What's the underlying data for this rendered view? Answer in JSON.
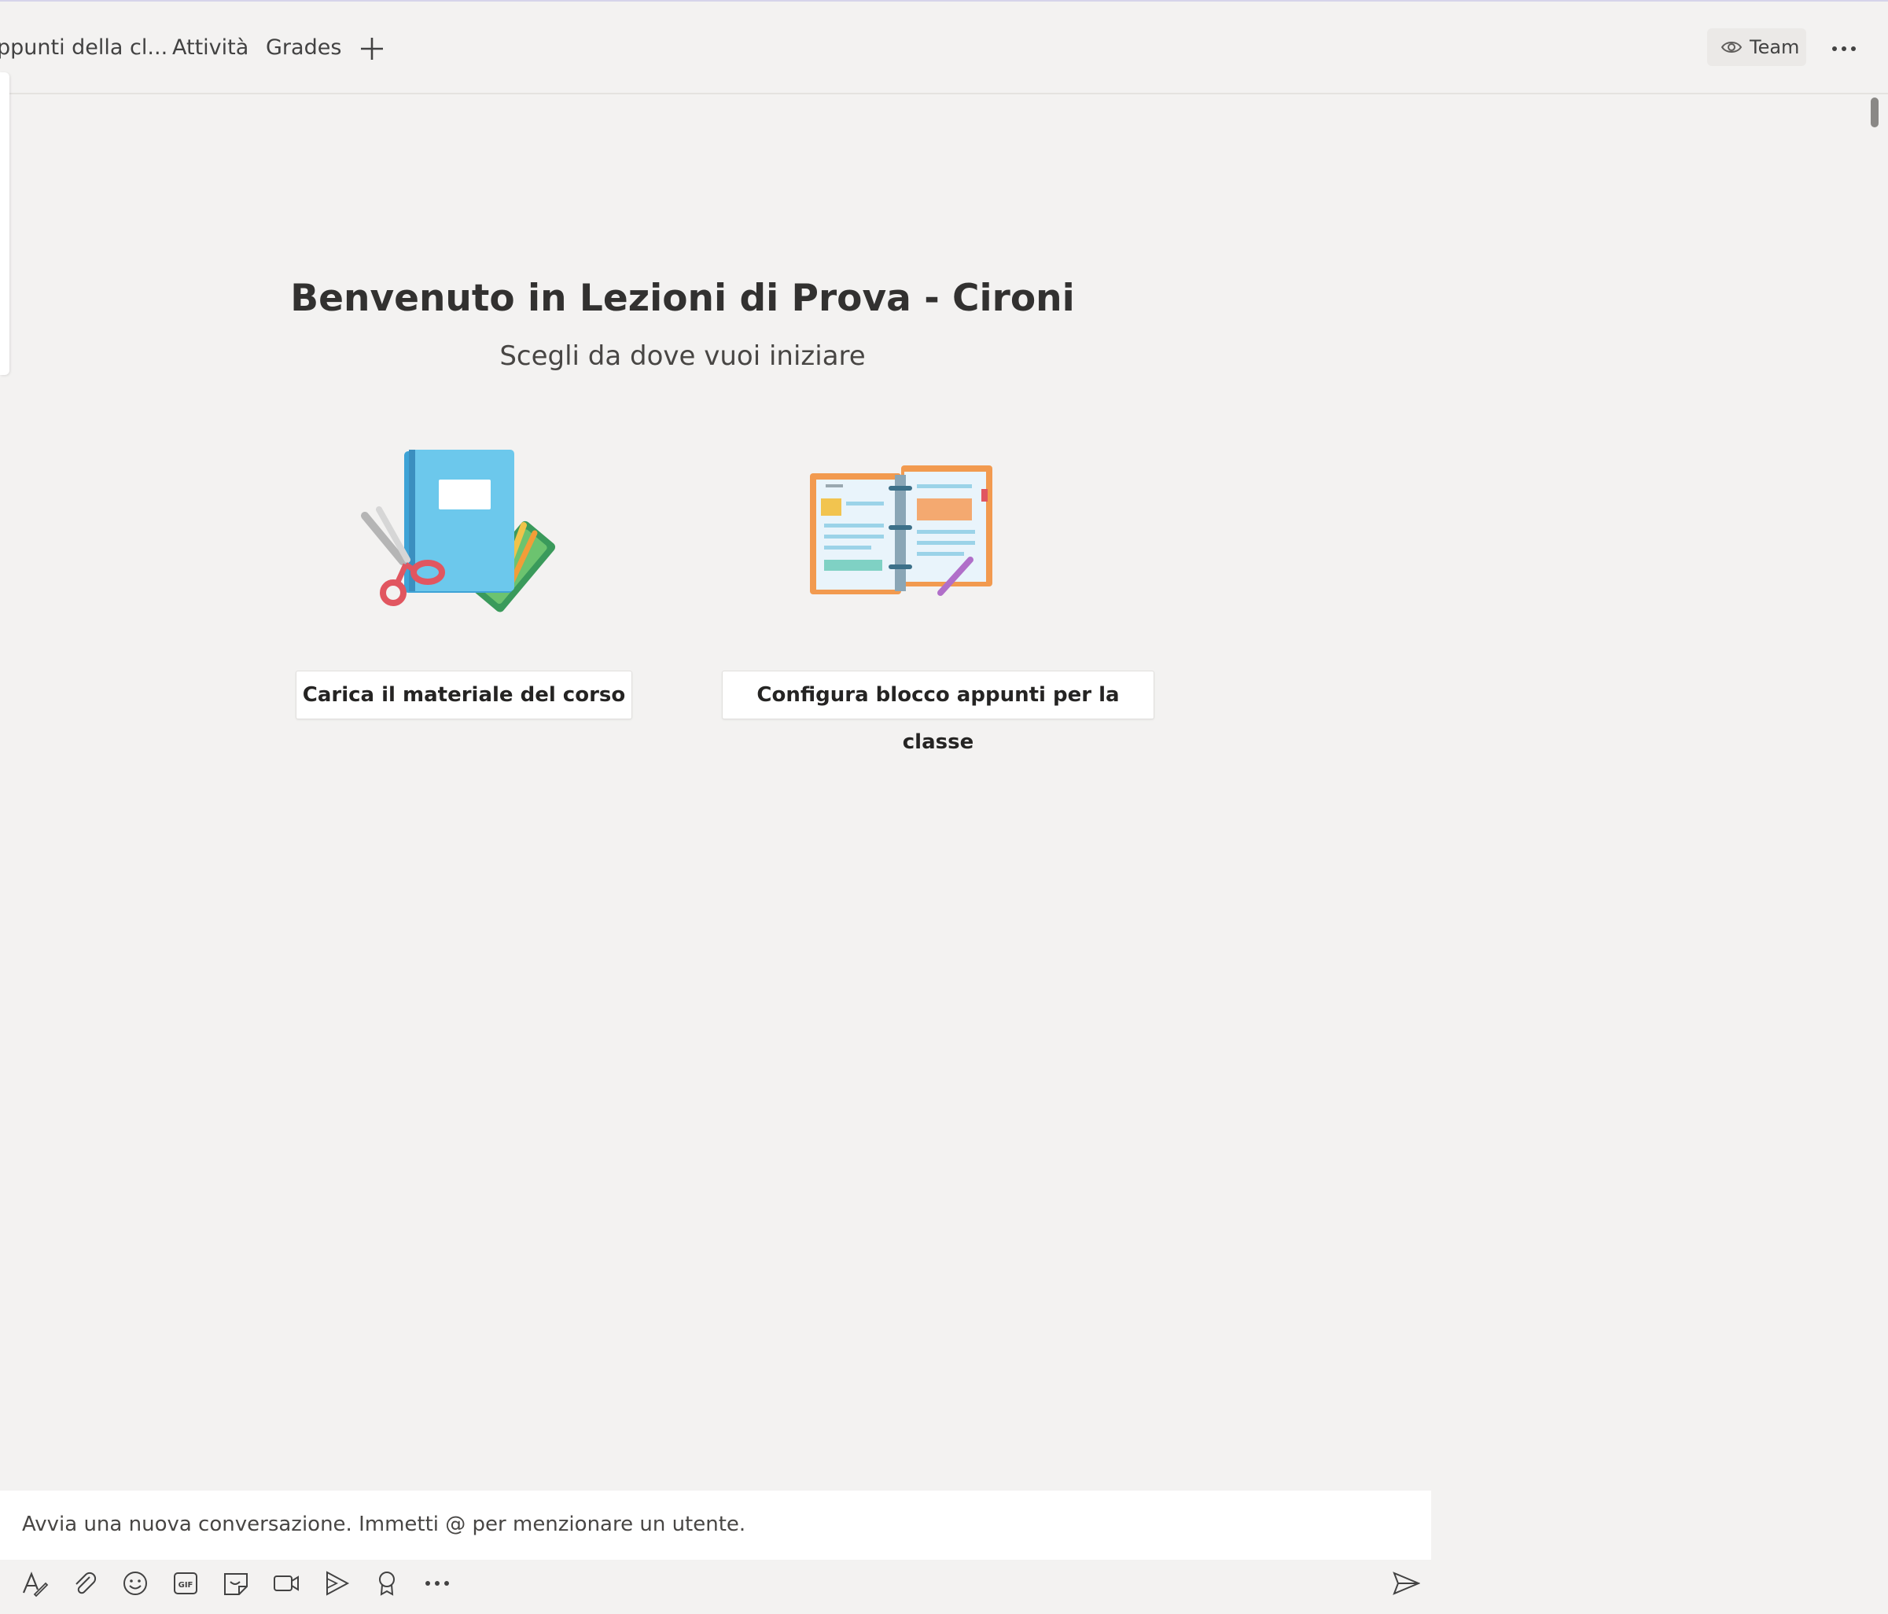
{
  "tabs": {
    "notes_label": "ppunti della cl...",
    "activity_label": "Attività",
    "grades_label": "Grades",
    "add_icon": "plus-icon"
  },
  "header_actions": {
    "team_label": "Team",
    "team_icon": "eye-icon",
    "more_icon": "more-horizontal-icon"
  },
  "welcome": {
    "title": "Benvenuto in Lezioni di Prova - Cironi",
    "subtitle": "Scegli da dove vuoi iniziare"
  },
  "actions": {
    "upload_label": "Carica il materiale del corso",
    "notebook_label": "Configura blocco appunti per la classe"
  },
  "compose": {
    "placeholder": "Avvia una nuova conversazione. Immetti @ per menzionare un utente.",
    "toolbar_icons": [
      "format-icon",
      "attach-icon",
      "emoji-icon",
      "gif-icon",
      "sticker-icon",
      "meet-now-icon",
      "stream-icon",
      "praise-icon",
      "more-options-icon"
    ],
    "send_icon": "send-icon"
  },
  "colors": {
    "background": "#f3f2f1",
    "surface": "#ffffff",
    "text_primary": "#323130",
    "text_secondary": "#484644"
  }
}
